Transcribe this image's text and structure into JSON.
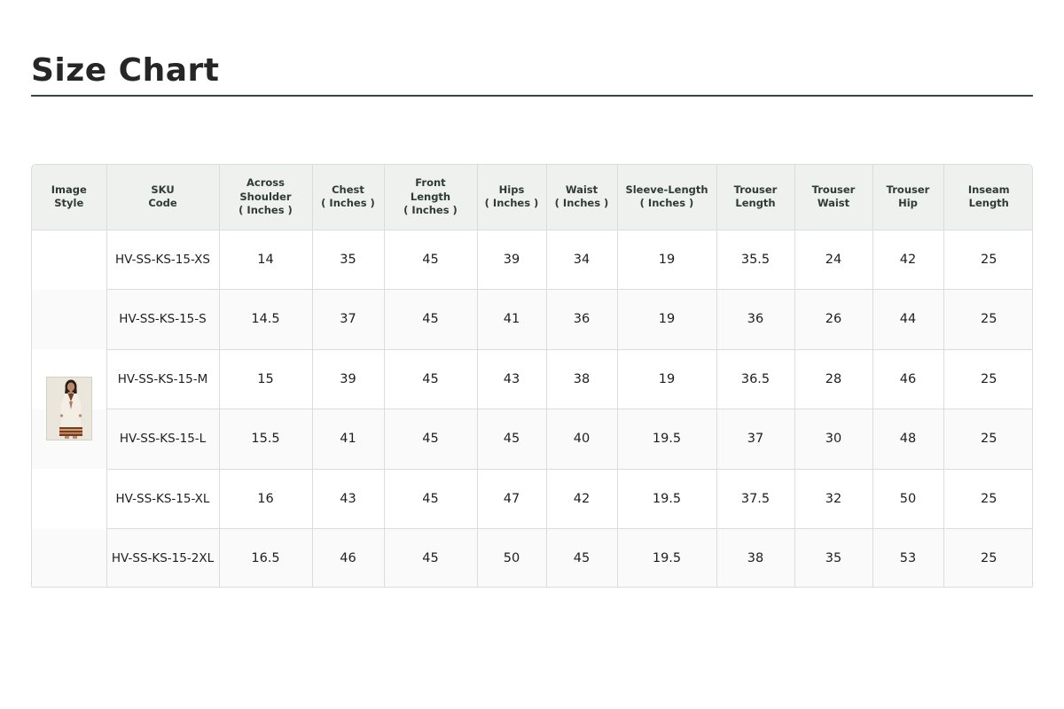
{
  "page": {
    "title": "Size Chart"
  },
  "table": {
    "headers": [
      [
        "Image",
        "Style"
      ],
      [
        "SKU",
        "Code"
      ],
      [
        "Across",
        "Shoulder",
        "( Inches )"
      ],
      [
        "Chest",
        "( Inches )"
      ],
      [
        "Front",
        "Length",
        "( Inches )"
      ],
      [
        "Hips",
        "( Inches )"
      ],
      [
        "Waist",
        "( Inches )"
      ],
      [
        "Sleeve-Length",
        "( Inches )"
      ],
      [
        "Trouser",
        "Length"
      ],
      [
        "Trouser",
        "Waist"
      ],
      [
        "Trouser",
        "Hip"
      ],
      [
        "Inseam",
        "Length"
      ]
    ],
    "rows": [
      [
        "HV-SS-KS-15-XS",
        "14",
        "35",
        "45",
        "39",
        "34",
        "19",
        "35.5",
        "24",
        "42",
        "25"
      ],
      [
        "HV-SS-KS-15-S",
        "14.5",
        "37",
        "45",
        "41",
        "36",
        "19",
        "36",
        "26",
        "44",
        "25"
      ],
      [
        "HV-SS-KS-15-M",
        "15",
        "39",
        "45",
        "43",
        "38",
        "19",
        "36.5",
        "28",
        "46",
        "25"
      ],
      [
        "HV-SS-KS-15-L",
        "15.5",
        "41",
        "45",
        "45",
        "40",
        "19.5",
        "37",
        "30",
        "48",
        "25"
      ],
      [
        "HV-SS-KS-15-XL",
        "16",
        "43",
        "45",
        "47",
        "42",
        "19.5",
        "37.5",
        "32",
        "50",
        "25"
      ],
      [
        "HV-SS-KS-15-2XL",
        "16.5",
        "46",
        "45",
        "50",
        "45",
        "19.5",
        "38",
        "35",
        "53",
        "25"
      ]
    ]
  },
  "image": {
    "icon": "product-thumbnail",
    "colors": {
      "dress": "#f3eee3",
      "border_print": "#7a3b24",
      "hair": "#2a1d17",
      "skin": "#b98a6e",
      "background": "#ebe6db"
    }
  },
  "colors": {
    "header_bg": "#eef1ee",
    "rule": "#2f4a44",
    "grid": "#d9dedc",
    "alt_row": "#f9faf9"
  }
}
